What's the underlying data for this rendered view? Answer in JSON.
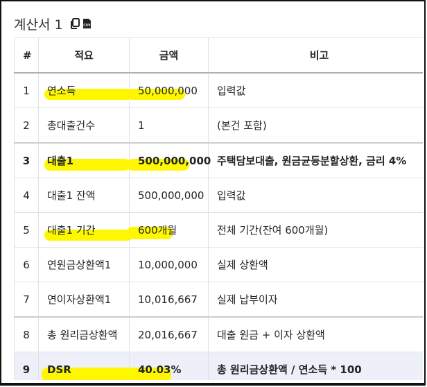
{
  "title": "계산서 1",
  "icons": {
    "copy": "copy-icon",
    "csv": "csv-file-icon"
  },
  "csv_icon_text": "CSV",
  "table": {
    "headers": [
      "#",
      "적요",
      "금액",
      "비고"
    ],
    "rows": [
      {
        "no": "1",
        "item": "연소득",
        "amount": "50,000,000",
        "note": "입력값"
      },
      {
        "no": "2",
        "item": "총대출건수",
        "amount": "1",
        "note": "(본건 포함)"
      },
      {
        "no": "3",
        "item": "대출1",
        "amount": "500,000,000",
        "note": "주택담보대출, 원금균등분할상환, 금리 4%"
      },
      {
        "no": "4",
        "item": "대출1 잔액",
        "amount": "500,000,000",
        "note": "입력값"
      },
      {
        "no": "5",
        "item": "대출1 기간",
        "amount": "600개월",
        "note": "전체 기간(잔여 600개월)"
      },
      {
        "no": "6",
        "item": "연원금상환액1",
        "amount": "10,000,000",
        "note": "실제 상환액"
      },
      {
        "no": "7",
        "item": "연이자상환액1",
        "amount": "10,016,667",
        "note": "실제 납부이자"
      },
      {
        "no": "8",
        "item": "총 원리금상환액",
        "amount": "20,016,667",
        "note": "대출 원금 + 이자 상환액"
      },
      {
        "no": "9",
        "item": "DSR",
        "amount": "40.03%",
        "note": "총 원리금상환액 / 연소득 * 100"
      }
    ]
  },
  "highlight_color": "#fff700"
}
